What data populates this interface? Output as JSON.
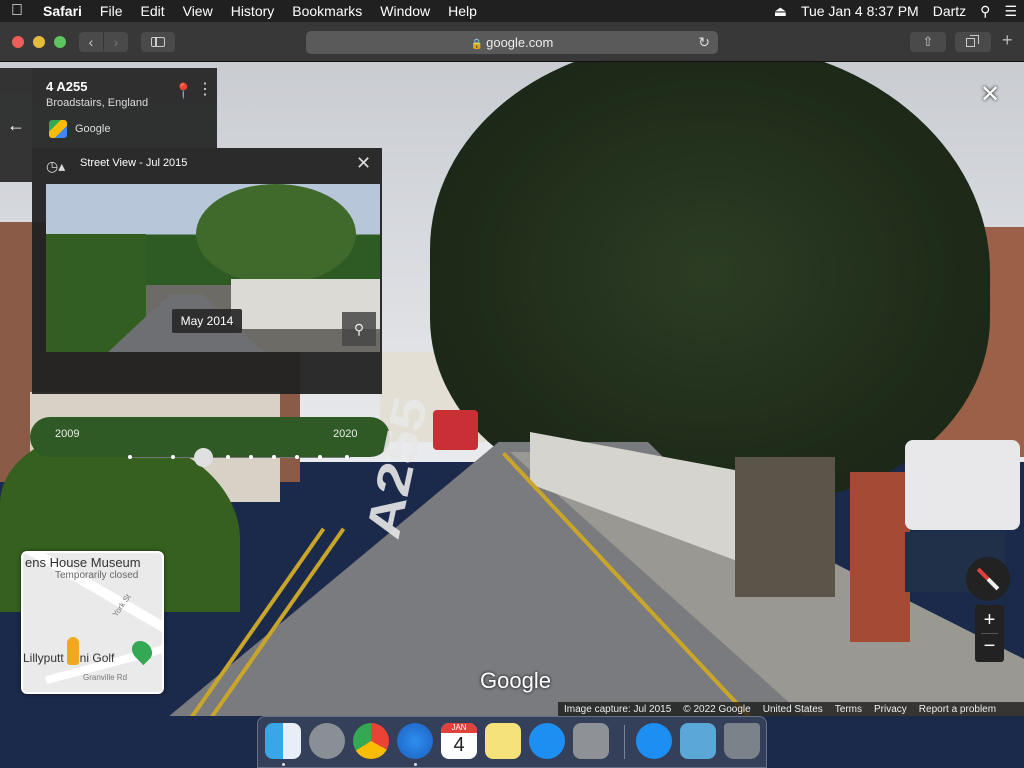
{
  "menubar": {
    "apple": "",
    "items": [
      "Safari",
      "File",
      "Edit",
      "View",
      "History",
      "Bookmarks",
      "Window",
      "Help"
    ],
    "datetime": "Tue Jan 4  8:37 PM",
    "user": "Dartz"
  },
  "toolbar": {
    "url": "google.com"
  },
  "address_card": {
    "title": "4 A255",
    "subtitle": "Broadstairs, England",
    "source": "Google"
  },
  "time_machine": {
    "title": "Street View - Jul 2015",
    "tooltip": "May 2014",
    "year_start": "2009",
    "year_end": "2020",
    "slider_position": 0.34
  },
  "road_marking": "A255",
  "watermark": "Google",
  "minimap": {
    "place": "ens House Museum",
    "status": "Temporarily closed",
    "street1": "York St",
    "poi": "Lillyputt Mini Golf",
    "street2": "Granville Rd"
  },
  "attribution": {
    "capture": "Image capture: Jul 2015",
    "copyright": "© 2022 Google",
    "region": "United States",
    "terms": "Terms",
    "privacy": "Privacy",
    "report": "Report a problem"
  },
  "dock": {
    "calendar_month": "JAN",
    "calendar_day": "4"
  },
  "colors": {
    "menubar": "#202020",
    "toolbar": "#383838",
    "panel": "#222222",
    "dock_bg": "#1b2a4a"
  }
}
